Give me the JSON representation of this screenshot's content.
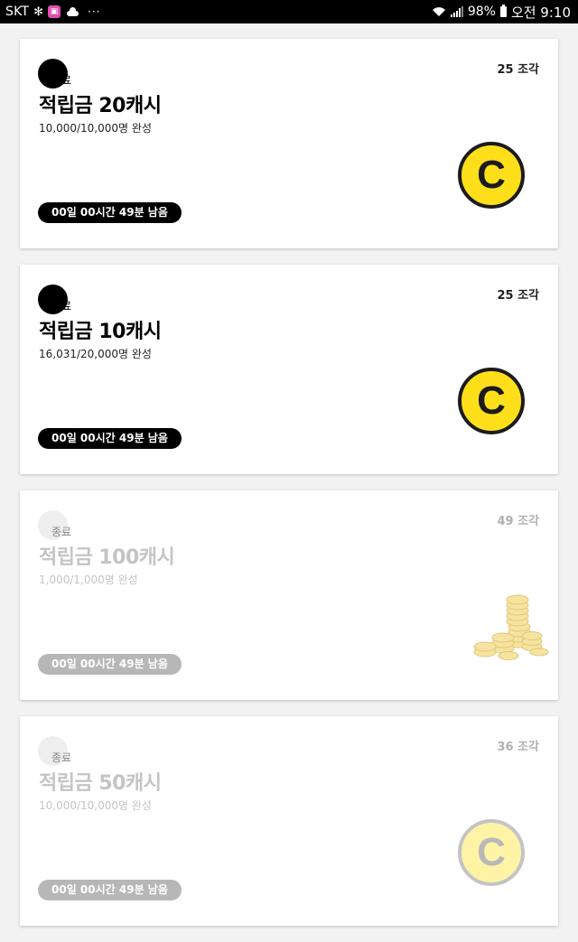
{
  "status_bar": {
    "carrier": "SKT",
    "app_icons": [
      "fan-icon",
      "app-icon",
      "cloud-icon"
    ],
    "more": "···",
    "battery": "98%",
    "time": "오전 9:10"
  },
  "cards": [
    {
      "status_label": "완료",
      "pieces": "25 조각",
      "title": "적립금 20캐시",
      "progress": "10,000/10,000명 완성",
      "timer": "00일 00시간 49분 남음",
      "image": "cash-coin-icon",
      "active": true
    },
    {
      "status_label": "완료",
      "pieces": "25 조각",
      "title": "적립금 10캐시",
      "progress": "16,031/20,000명 완성",
      "timer": "00일 00시간 49분 남음",
      "image": "cash-coin-icon",
      "active": true
    },
    {
      "status_label": "종료",
      "pieces": "49 조각",
      "title": "적립금 100캐시",
      "progress": "1,000/1,000명 완성",
      "timer": "00일 00시간 49분 남음",
      "image": "gold-coin-stack-icon",
      "active": false
    },
    {
      "status_label": "종료",
      "pieces": "36 조각",
      "title": "적립금 50캐시",
      "progress": "10,000/10,000명 완성",
      "timer": "00일 00시간 49분 남음",
      "image": "cash-coin-icon",
      "active": false
    }
  ],
  "colors": {
    "coin_yellow": "#ffdf1a",
    "badge_active": "#000000",
    "timer_active": "#000000",
    "timer_ended": "#b7b7b7",
    "text_ended": "#c4c4c4"
  }
}
